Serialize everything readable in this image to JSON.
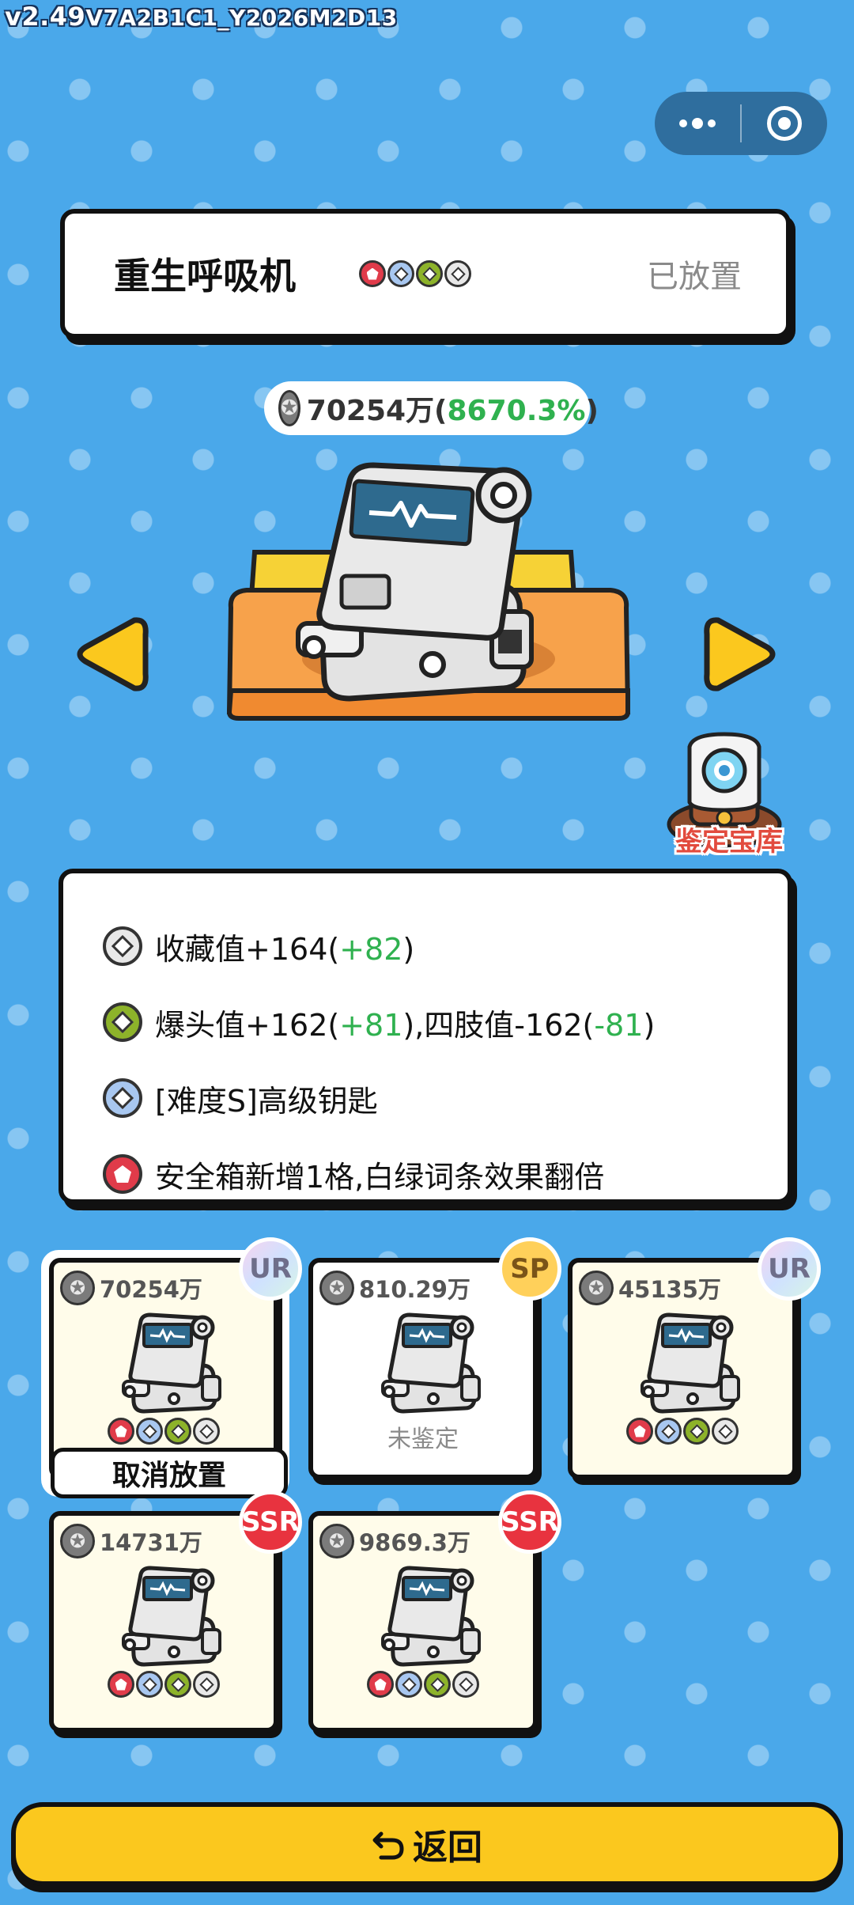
{
  "version": {
    "main": "v2.49",
    "build": "V7A2B1C1_Y2026M2D13"
  },
  "capsule": {
    "more_icon": "more-dots-icon",
    "close_icon": "target-icon"
  },
  "item": {
    "name": "重生呼吸机",
    "status": "已放置",
    "gems": [
      "red",
      "blue",
      "green",
      "gray"
    ],
    "value": "70254万",
    "value_paren_open": "(",
    "value_percent": "8670.3%",
    "value_paren_close": ")"
  },
  "nav": {
    "prev_icon": "arrow-left-icon",
    "next_icon": "arrow-right-icon"
  },
  "appraise": {
    "label": "鉴定宝库"
  },
  "stats": [
    {
      "gem": "gray",
      "text": "收藏值+164(",
      "bonus": "+82",
      "end": ")"
    },
    {
      "gem": "green",
      "text": "爆头值+162(",
      "bonus": "+81",
      "mid": "),四肢值-162(",
      "bonus2": "-81",
      "end": ")"
    },
    {
      "gem": "blue",
      "text": "[难度S]高级钥匙"
    },
    {
      "gem": "red",
      "text": "安全箱新增1格,白绿词条效果翻倍"
    }
  ],
  "tiles": [
    {
      "price": "70254万",
      "rarity": "UR",
      "gems": [
        "red",
        "blue",
        "green",
        "gray"
      ],
      "selected": true,
      "action": "取消放置"
    },
    {
      "price": "810.29万",
      "rarity": "SP",
      "note": "未鉴定"
    },
    {
      "price": "45135万",
      "rarity": "UR",
      "gems": [
        "red",
        "blue",
        "green",
        "gray"
      ]
    },
    {
      "price": "14731万",
      "rarity": "SSR",
      "gems": [
        "red",
        "blue",
        "green",
        "gray"
      ]
    },
    {
      "price": "9869.3万",
      "rarity": "SSR",
      "gems": [
        "red",
        "blue",
        "green",
        "gray"
      ]
    }
  ],
  "footer": {
    "back_label": "返回",
    "back_icon": "return-arrow-icon"
  },
  "colors": {
    "background": "#4aa8ea",
    "accent_yellow": "#fbc81e",
    "bonus_green": "#2fb14f",
    "badge_red": "#e8333f"
  }
}
